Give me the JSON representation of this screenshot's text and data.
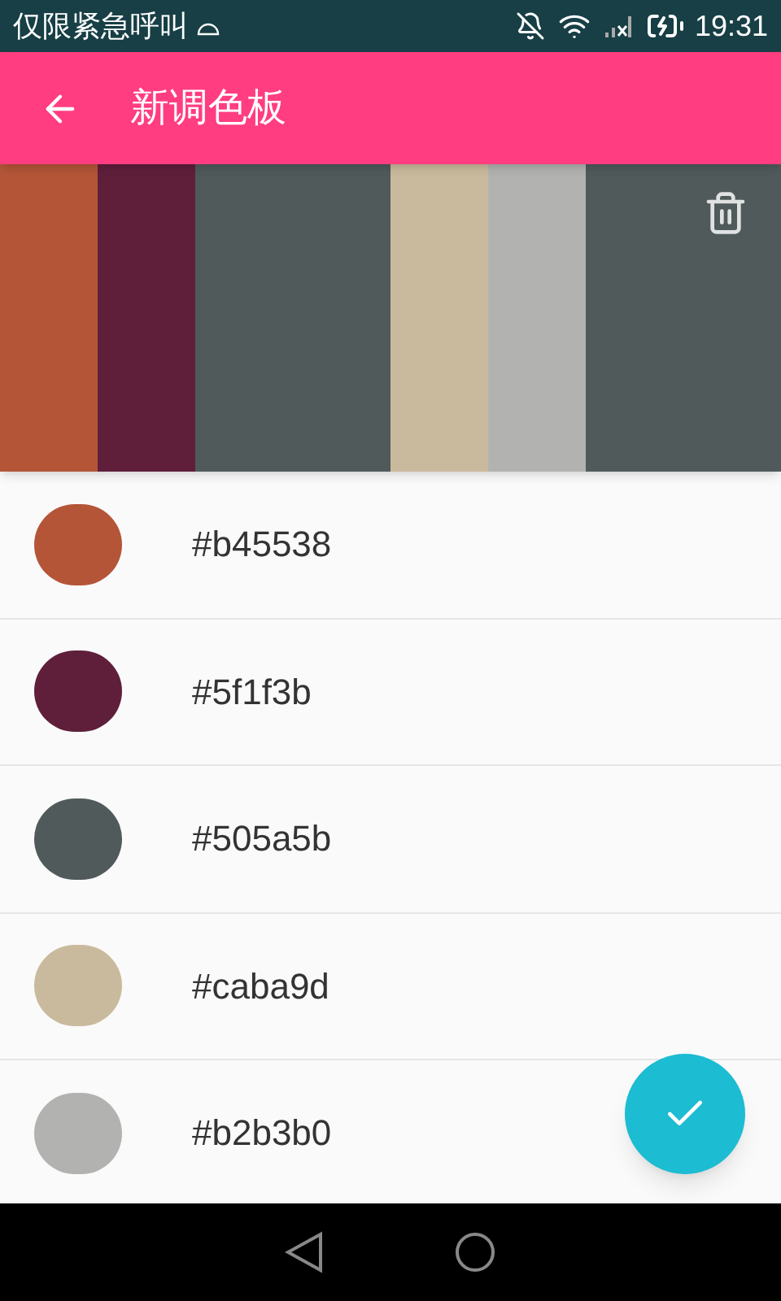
{
  "status_bar": {
    "carrier": "仅限紧急呼叫",
    "time": "19:31"
  },
  "app_bar": {
    "title": "新调色板"
  },
  "palette_strip": [
    {
      "color": "#b45538"
    },
    {
      "color": "#5f1f3b"
    },
    {
      "color": "#505a5b"
    },
    {
      "color": "#505a5b"
    },
    {
      "color": "#caba9d"
    },
    {
      "color": "#b2b3b0"
    },
    {
      "color": "#505a5b"
    },
    {
      "color": "#505a5b"
    }
  ],
  "colors": [
    {
      "hex": "#b45538",
      "color": "#b45538"
    },
    {
      "hex": "#5f1f3b",
      "color": "#5f1f3b"
    },
    {
      "hex": "#505a5b",
      "color": "#505a5b"
    },
    {
      "hex": "#caba9d",
      "color": "#caba9d"
    },
    {
      "hex": "#b2b3b0",
      "color": "#b2b3b0"
    }
  ]
}
